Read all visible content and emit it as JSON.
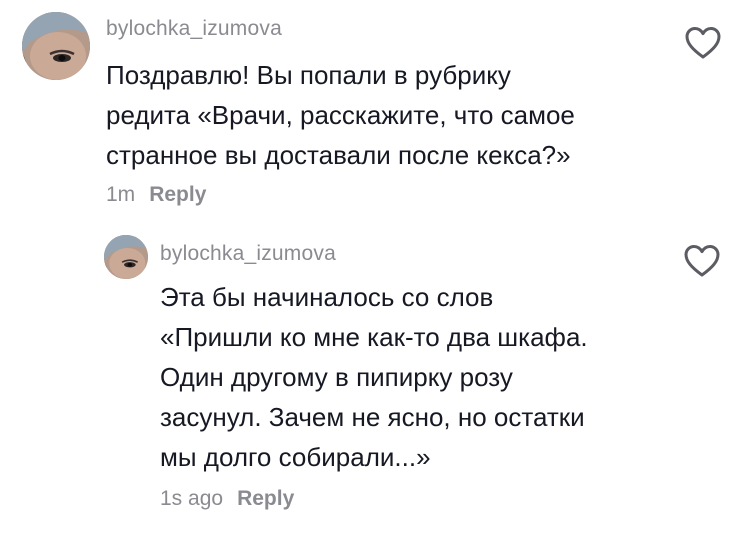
{
  "comments": [
    {
      "username": "bylochka_izumova",
      "lines": [
        "Поздравлю! Вы попали в рубрику",
        "редита «Врачи, расскажите, что самое",
        "странное вы доставали после кекса?»"
      ],
      "time": "1m",
      "reply_label": "Reply",
      "like_icon": "heart-outline-icon"
    },
    {
      "username": "bylochka_izumova",
      "lines": [
        "Эта бы начиналось со слов",
        "«Пришли ко мне как-то два шкафа.",
        "Один другому в пипирку розу",
        "засунул. Зачем не ясно, но остатки",
        "мы долго собирали...»"
      ],
      "time": "1s ago",
      "reply_label": "Reply",
      "like_icon": "heart-outline-icon"
    }
  ],
  "colors": {
    "text": "#161823",
    "secondary": "#8a8b91",
    "heart_stroke": "#5c5d63"
  }
}
